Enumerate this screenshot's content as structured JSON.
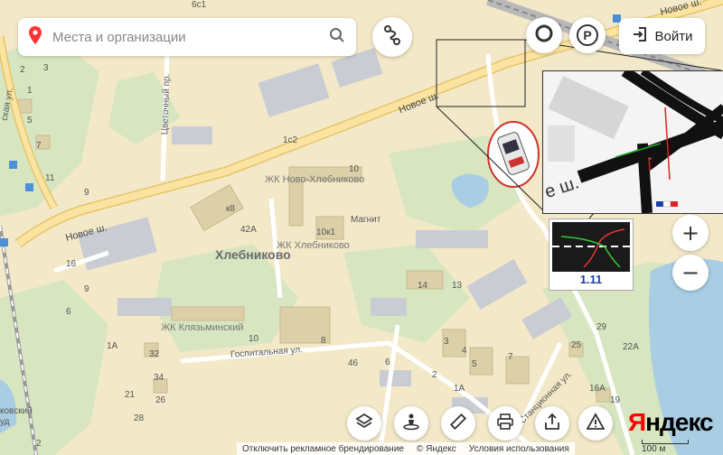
{
  "search": {
    "placeholder": "Места и организации",
    "icon": "search-icon"
  },
  "buttons": {
    "routes_icon": "route-icon",
    "layers_icon": "circle-ring-icon",
    "parking_label": "P",
    "login_label": "Войти"
  },
  "zoom": {
    "in": "+",
    "out": "−"
  },
  "labels": {
    "district": "Хлебниково",
    "road_new_1": "Новое ш.",
    "road_new_2": "Новое ш.",
    "road_new_3": "Новое ш.",
    "street_tsvetochny": "Цветочный пр.",
    "street_gospital": "Госпитальная ул.",
    "street_station": "Станционная ул.",
    "jk_novo": "ЖК Ново-Хлебниково",
    "jk_khleb": "ЖК Хлебниково",
    "jk_klyaz": "ЖК Клязьминский",
    "shop": "Магнит",
    "street_left": "ская ул.",
    "street_left2": "ковский",
    "street_left3": "уд"
  },
  "house_numbers": [
    "6с1",
    "1с2",
    "10",
    "к8",
    "42А",
    "10к1",
    "16",
    "14",
    "13",
    "1А",
    "32",
    "34",
    "21",
    "26",
    "28",
    "10",
    "8",
    "46",
    "6",
    "3",
    "4",
    "2",
    "5",
    "7",
    "1А",
    "29",
    "25",
    "22А",
    "16А",
    "19",
    "11",
    "9",
    "7",
    "5",
    "6",
    "9",
    "3",
    "2",
    "1",
    "2"
  ],
  "inset_text": "е ш.",
  "sign": {
    "number": "1.11"
  },
  "toolbar": [
    "layers-icon",
    "panorama-icon",
    "ruler-icon",
    "print-icon",
    "share-icon",
    "warning-icon"
  ],
  "footer": {
    "ad": "Отключить рекламное брендирование",
    "copyright": "© Яндекс",
    "terms": "Условия использования"
  },
  "logo": {
    "first": "Я",
    "rest": "ндекс"
  },
  "scale": "100 м"
}
